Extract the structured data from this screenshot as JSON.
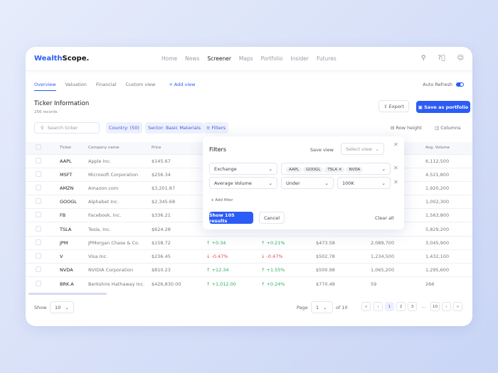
{
  "app": {
    "brand_a": "Wealth",
    "brand_b": "Scope."
  },
  "nav": [
    "Home",
    "News",
    "Screener",
    "Maps",
    "Portfolio",
    "Insider",
    "Futures"
  ],
  "tabs": [
    "Overview",
    "Valuation",
    "Financial",
    "Custom view"
  ],
  "add_view": "+ Add view",
  "auto_refresh": "Auto Refresh",
  "title": "Ticker Information",
  "records": "256 records",
  "export": "Export",
  "save_portfolio": "Save as portfolio",
  "search_placeholder": "Search ticker",
  "chips": [
    "Country: (50)",
    "Sector: Basic Materials",
    "Filters"
  ],
  "row_height": "Row height",
  "columns": "Columns",
  "headers": [
    "Ticker",
    "Company name",
    "Price",
    "",
    "",
    "",
    "",
    "Avg. Volume"
  ],
  "rows": [
    [
      "AAPL",
      "Apple Inc.",
      "$145.67",
      "",
      "",
      "",
      "",
      "6,112,500"
    ],
    [
      "MSFT",
      "Microsoft Corporation",
      "$256.34",
      "",
      "",
      "",
      "",
      "4,521,800"
    ],
    [
      "AMZN",
      "Amazon.com",
      "$3,201.87",
      "",
      "",
      "",
      "",
      "1,920,200"
    ],
    [
      "GOOGL",
      "Alphabet Inc.",
      "$2,345.68",
      "",
      "",
      "",
      "",
      "1,002,300"
    ],
    [
      "FB",
      "Facebook, Inc.",
      "$336.21",
      "",
      "",
      "",
      "",
      "1,563,800"
    ],
    [
      "TSLA",
      "Tesla, Inc.",
      "$624.28",
      "",
      "",
      "",
      "",
      "5,829,200"
    ],
    [
      "JPM",
      "JPMorgan Chase & Co.",
      "$158.72",
      "↑ +0.34",
      "↑ +0.21%",
      "$473.58",
      "2,089,700",
      "3,045,900"
    ],
    [
      "V",
      "Visa Inc.",
      "$236.45",
      "↓ -0.47%",
      "↓ -0.47%",
      "$502.78",
      "1,234,500",
      "1,432,100"
    ],
    [
      "NVDA",
      "NVIDIA Corporation",
      "$810.23",
      "↑ +12.34",
      "↑ +1.55%",
      "$500.98",
      "1,065,200",
      "1,295,600"
    ],
    [
      "BRK.A",
      "Berkshire Hathaway Inc.",
      "$426,830.00",
      "↑ +1,012.00",
      "↑ +0.24%",
      "$770.48",
      "59",
      "266"
    ]
  ],
  "footer": {
    "show": "Show",
    "show_value": "10",
    "page": "Page",
    "page_value": "1",
    "of": "of 10",
    "pages": [
      "«",
      "‹",
      "1",
      "2",
      "3",
      "...",
      "10",
      "›",
      "»"
    ]
  },
  "filters": {
    "title": "Filters",
    "save_view": "Save view",
    "select_view": "Select view",
    "row1_field": "Exchange",
    "row1_tags": [
      "AAPL",
      "GOOGL",
      "TSLA",
      "NVDA"
    ],
    "row2_field": "Average Volume",
    "row2_op": "Under",
    "row2_value": "100K",
    "add_filter": "+ Add filter",
    "show_results": "Show 105 results",
    "cancel": "Cancel",
    "clear_all": "Clear all"
  },
  "colors": {
    "accent": "#2b5cf6",
    "up": "#2fae62",
    "down": "#e2485a"
  }
}
